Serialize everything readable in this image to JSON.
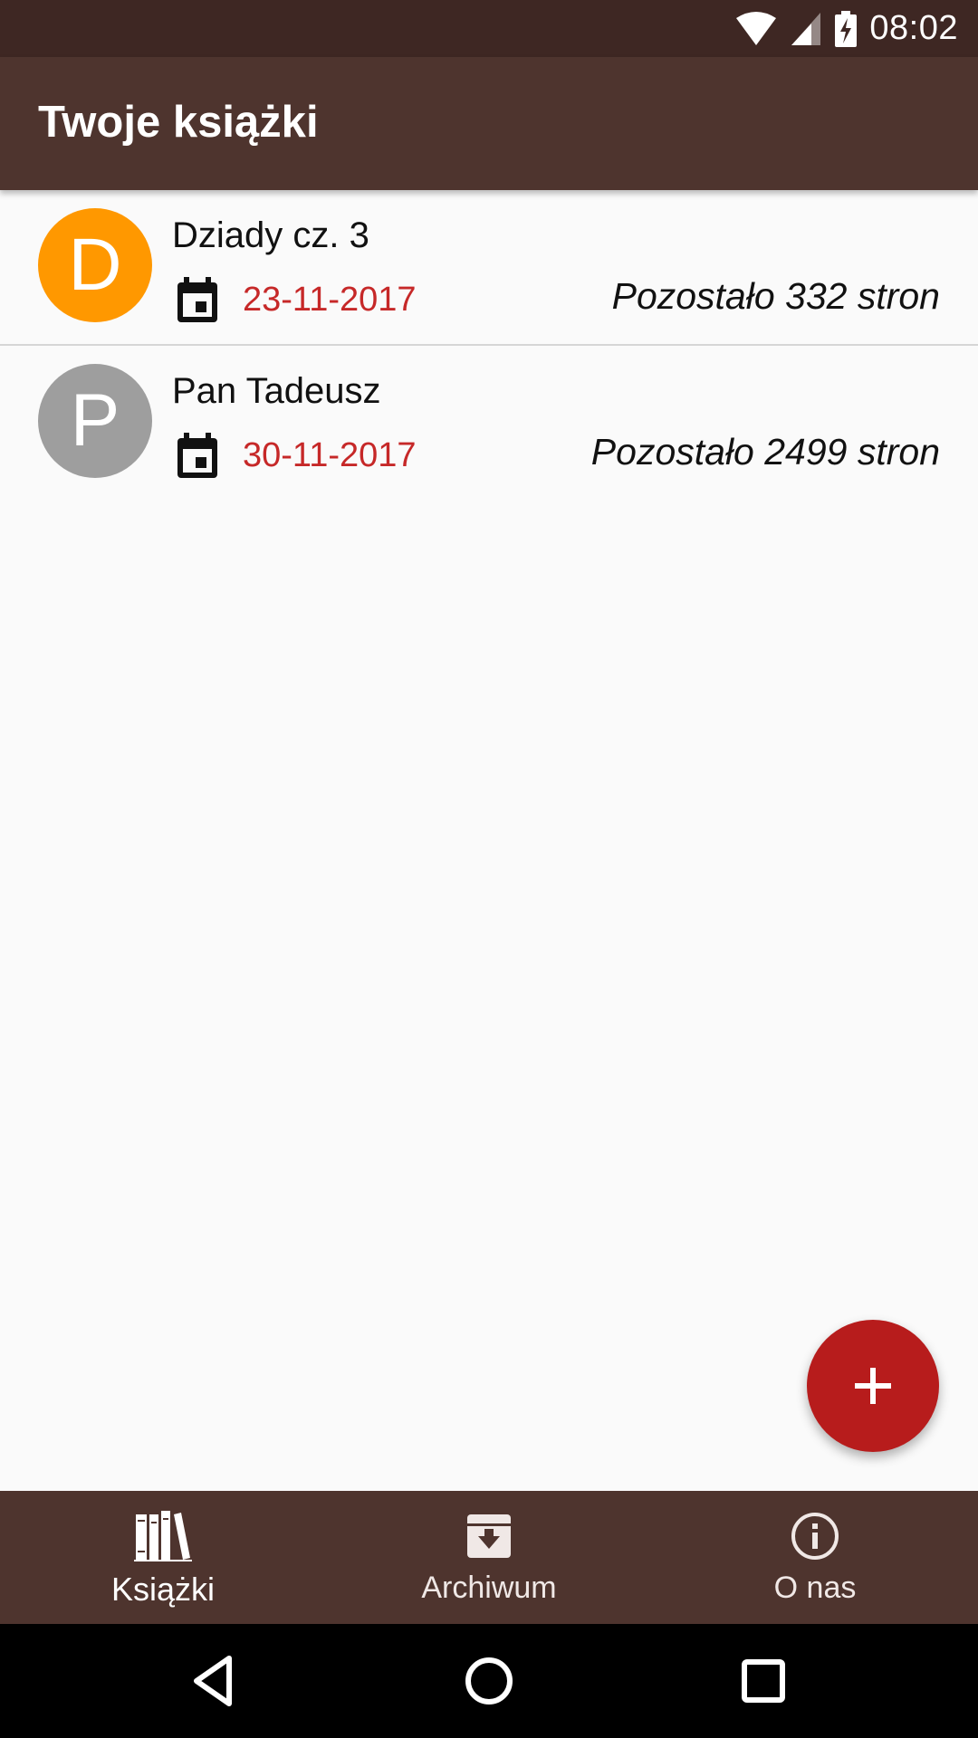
{
  "status_bar": {
    "time": "08:02",
    "icons": [
      "wifi-icon",
      "cell-signal-icon",
      "battery-charging-icon"
    ]
  },
  "app_bar": {
    "title": "Twoje książki"
  },
  "books": [
    {
      "initial": "D",
      "title": "Dziady cz. 3",
      "date": "23-11-2017",
      "remaining": "Pozostało 332 stron",
      "avatar_color": "#ff9800"
    },
    {
      "initial": "P",
      "title": "Pan Tadeusz",
      "date": "30-11-2017",
      "remaining": "Pozostało 2499 stron",
      "avatar_color": "#9e9e9e"
    }
  ],
  "fab": {
    "icon": "plus-icon",
    "color": "#b71c1c"
  },
  "bottom_nav": {
    "items": [
      {
        "label": "Książki",
        "icon": "books-icon",
        "active": true
      },
      {
        "label": "Archiwum",
        "icon": "archive-icon",
        "active": false
      },
      {
        "label": "O nas",
        "icon": "info-icon",
        "active": false
      }
    ]
  },
  "system_nav": {
    "icons": [
      "back-icon",
      "home-icon",
      "recents-icon"
    ]
  },
  "colors": {
    "primary": "#4e342e",
    "primary_dark": "#3e2723",
    "accent": "#b71c1c",
    "date_red": "#c62828"
  }
}
